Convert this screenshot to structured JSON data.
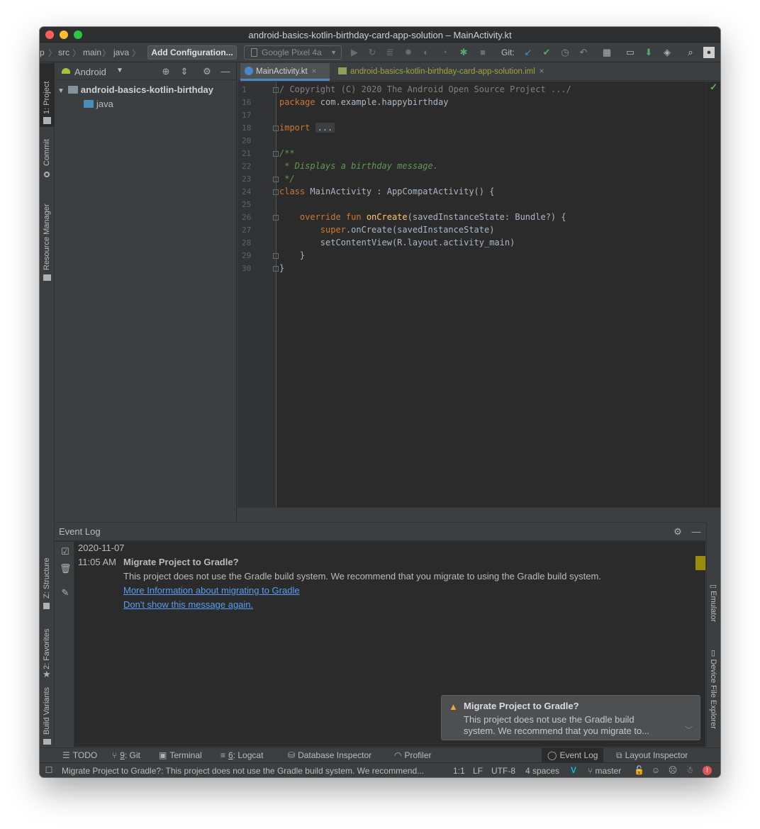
{
  "window": {
    "title": "android-basics-kotlin-birthday-card-app-solution – MainActivity.kt"
  },
  "nav": {
    "crumbs": [
      "p",
      "src",
      "main",
      "java"
    ],
    "add_config": "Add Configuration...",
    "device": "Google Pixel 4a",
    "git_label": "Git:"
  },
  "left_tabs": {
    "project": "1: Project",
    "commit": "Commit",
    "resource_manager": "Resource Manager",
    "structure": "Z: Structure",
    "favorites": "2: Favorites",
    "build_variants": "Build Variants"
  },
  "project": {
    "view": "Android",
    "root": "android-basics-kotlin-birthday",
    "child": "java"
  },
  "editor": {
    "tabs": [
      {
        "label": "MainActivity.kt"
      },
      {
        "label": "android-basics-kotlin-birthday-card-app-solution.iml"
      }
    ],
    "line_numbers": [
      "1",
      "16",
      "17",
      "18",
      "20",
      "21",
      "22",
      "23",
      "24",
      "25",
      "26",
      "27",
      "28",
      "29",
      "30"
    ],
    "code": {
      "l1": "/ Copyright (C) 2020 The Android Open Source Project .../",
      "l16_kw": "package",
      "l16_rest": " com.example.happybirthday",
      "l18_kw": "import",
      "l18_fold": "...",
      "l21": "/**",
      "l22": " * Displays a birthday message.",
      "l23": " */",
      "l24_kw": "class",
      "l24_rest": " MainActivity : AppCompatActivity() {",
      "l26_kw": "    override fun",
      "l26_fn": " onCreate",
      "l26_rest": "(savedInstanceState: Bundle?) {",
      "l27_kw": "        super",
      "l27_rest": ".onCreate(savedInstanceState)",
      "l28": "        setContentView(R.layout.activity_main)",
      "l29": "    }",
      "l30": "}"
    }
  },
  "event_log": {
    "title": "Event Log",
    "date": "2020-11-07",
    "time": "11:05 AM",
    "headline": "Migrate Project to Gradle?",
    "message": "This project does not use the Gradle build system. We recommend that you migrate to using the Gradle build system.",
    "link_more": "More Information about migrating to Gradle",
    "link_dont_show": "Don't show this message again."
  },
  "right_tabs": {
    "emulator": "Emulator",
    "device_file_explorer": "Device File Explorer"
  },
  "balloon": {
    "title": "Migrate Project to Gradle?",
    "line1": "This project does not use the Gradle build",
    "line2": "system. We recommend that you migrate to..."
  },
  "bottom_tools": {
    "todo": "TODO",
    "git_num": "9",
    "git_rest": ": Git",
    "terminal": "Terminal",
    "logcat_num": "6",
    "logcat_rest": ": Logcat",
    "database": "Database Inspector",
    "profiler": "Profiler",
    "event_log": "Event Log",
    "layout_inspector": "Layout Inspector"
  },
  "status": {
    "message": "Migrate Project to Gradle?: This project does not use the Gradle build system. We recommend...",
    "position": "1:1",
    "line_sep": "LF",
    "encoding": "UTF-8",
    "indent": "4 spaces",
    "branch": "master"
  },
  "colors": {
    "background": "#2b2b2b",
    "panel": "#3c3f41",
    "keyword": "#cc7832",
    "comment": "#629755",
    "function": "#ffc66d",
    "link": "#589df6",
    "warning": "#f0a732"
  }
}
